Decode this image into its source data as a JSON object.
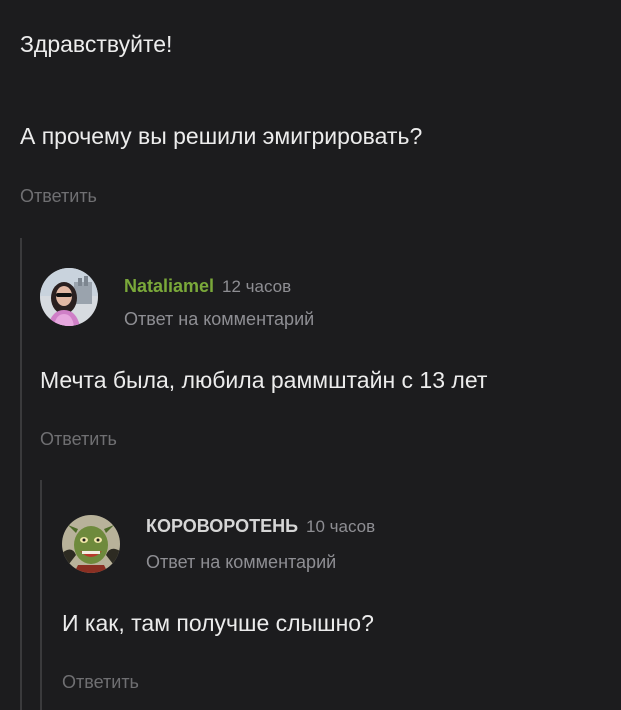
{
  "root_comment": {
    "greeting": "Здравствуйте!",
    "question": "А прочему вы решили эмигрировать?",
    "reply_label": "Ответить"
  },
  "reply1": {
    "author": "Nataliamel",
    "time": "12 часов",
    "subtitle": "Ответ на комментарий",
    "text": "Мечта была, любила раммштайн с 13 лет",
    "reply_label": "Ответить",
    "author_color": "#7aa83a"
  },
  "reply2": {
    "author": "КОРОВОРОТЕНЬ",
    "time": "10 часов",
    "subtitle": "Ответ на комментарий",
    "text": "И как, там получше слышно?",
    "reply_label": "Ответить",
    "author_color": "#d6d6d6"
  }
}
